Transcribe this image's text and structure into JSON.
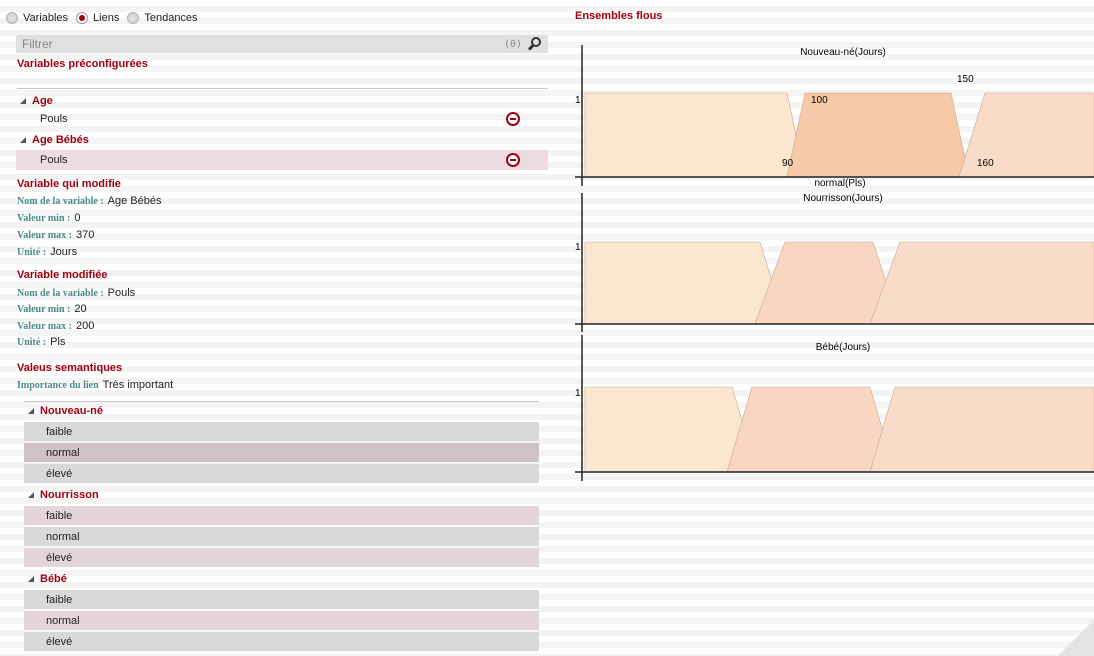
{
  "tabs": {
    "items": [
      {
        "label": "Variables",
        "selected": false
      },
      {
        "label": "Liens",
        "selected": true
      },
      {
        "label": "Tendances",
        "selected": false
      }
    ]
  },
  "filter": {
    "placeholder": "Filtrer",
    "count": "(0)"
  },
  "preconfigured": {
    "title": "Variables préconfigurées",
    "groups": [
      {
        "name": "Age",
        "items": [
          {
            "label": "Pouls",
            "selected": false
          }
        ]
      },
      {
        "name": "Age Bébés",
        "items": [
          {
            "label": "Pouls",
            "selected": true
          }
        ]
      }
    ]
  },
  "modifier": {
    "title": "Variable qui modifie",
    "name_key": "Nom de la variable :",
    "name_val": "Age Bébés",
    "min_key": "Valeur min :",
    "min_val": "0",
    "max_key": "Valeur max :",
    "max_val": "370",
    "unit_key": "Unité :",
    "unit_val": "Jours"
  },
  "modified": {
    "title": "Variable modifiée",
    "name_key": "Nom de la variable :",
    "name_val": "Pouls",
    "min_key": "Valeur min :",
    "min_val": "20",
    "max_key": "Valeur max :",
    "max_val": "200",
    "unit_key": "Unité :",
    "unit_val": "Pls"
  },
  "semantic": {
    "title": "Valeus semantiques",
    "importance_key": "Importance du lien",
    "importance_val": "Très important",
    "groups": [
      {
        "name": "Nouveau-né",
        "items": [
          "faible",
          "normal",
          "élevé"
        ]
      },
      {
        "name": "Nourrisson",
        "items": [
          "faible",
          "normal",
          "élevé"
        ]
      },
      {
        "name": "Bébé",
        "items": [
          "faible",
          "normal",
          "élevé"
        ]
      }
    ]
  },
  "fuzzy": {
    "title": "Ensembles flous",
    "y_label": "1",
    "charts": [
      {
        "title": "Nouveau-né(Jours)",
        "labels": [
          "150",
          "100",
          "90",
          "160"
        ],
        "bottom_label": "normal(Pls)"
      },
      {
        "title": "Nourrisson(Jours)",
        "labels": []
      },
      {
        "title": "Bébé(Jours)",
        "labels": []
      }
    ],
    "colors": {
      "light": "#fbe6cf",
      "mid": "#f7c9a8",
      "strong": "#f5b48f",
      "pale": "#f8dcc9"
    }
  }
}
